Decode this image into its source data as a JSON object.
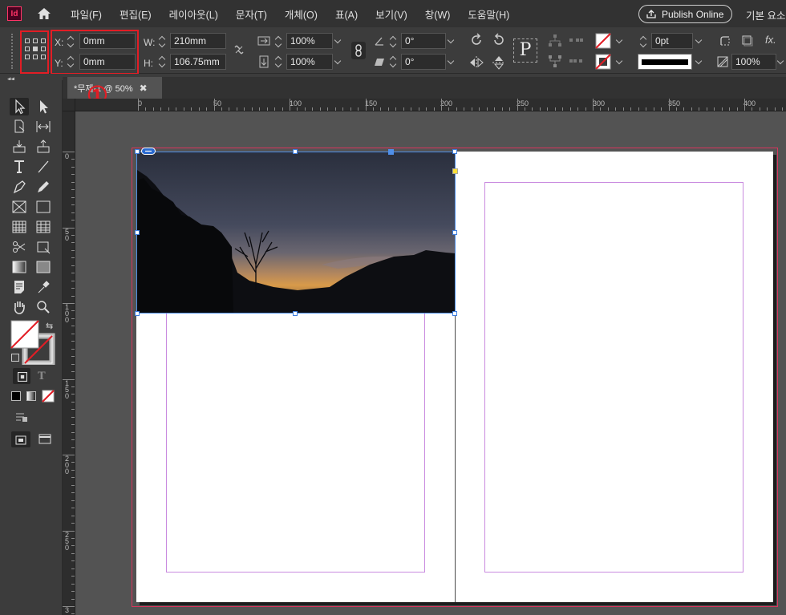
{
  "app": {
    "logo_text": "Id"
  },
  "menu": [
    "파일(F)",
    "편집(E)",
    "레이아웃(L)",
    "문자(T)",
    "개체(O)",
    "표(A)",
    "보기(V)",
    "창(W)",
    "도움말(H)"
  ],
  "publish_online": "Publish Online",
  "workspace": "기본 요소",
  "control": {
    "x_label": "X:",
    "x_value": "0mm",
    "y_label": "Y:",
    "y_value": "0mm",
    "w_label": "W:",
    "w_value": "210mm",
    "h_label": "H:",
    "h_value": "106.75mm",
    "scale_x": "100%",
    "scale_y": "100%",
    "rotate": "0°",
    "shear": "0°",
    "stroke_weight": "0pt",
    "opacity": "100%",
    "fx_label": "fx."
  },
  "annotations": {
    "circle_1": "①",
    "circle_2": "②"
  },
  "document_tab": {
    "title": "*무제-1 @ 50%",
    "close": "✖"
  },
  "ruler": {
    "top_labels": [
      "0",
      "50",
      "100",
      "150",
      "200",
      "250",
      "300",
      "350",
      "400"
    ],
    "left_labels": [
      "0",
      "5\n0",
      "1\n0\n0",
      "1\n5\n0",
      "2\n0\n0",
      "2\n5\n0",
      "3"
    ]
  },
  "colors": {
    "accent_red": "#e21d25",
    "selection_blue": "#4f8fe8",
    "margin_violet": "#c98adf",
    "bleed_red": "#d8355d"
  }
}
